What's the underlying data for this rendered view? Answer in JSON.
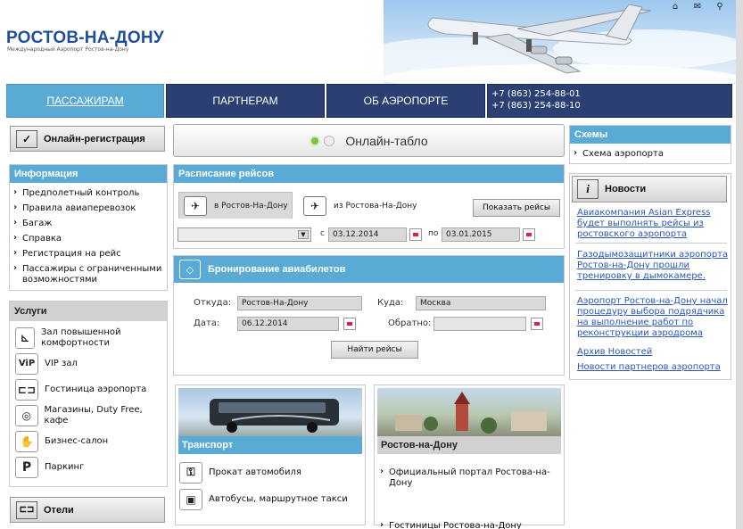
{
  "header": {
    "logo_title": "РОСТОВ-НА-ДОНУ",
    "logo_subtitle": "Международный Аэропорт Ростов-на-Дону",
    "icons": [
      "home-icon",
      "mail-icon",
      "sitemap-icon"
    ]
  },
  "nav": {
    "items": [
      "ПАССАЖИРАМ",
      "ПАРТНЕРАМ",
      "ОБ АЭРОПОРТЕ"
    ],
    "phone1": "+7 (863) 254-88-01",
    "phone2": "+7 (863) 254-88-10"
  },
  "left": {
    "checkin_label": "Онлайн-регистрация",
    "info_title": "Информация",
    "info_items": [
      "Предполетный контроль",
      "Правила авиаперевозок",
      "Багаж",
      "Справка",
      "Регистрация на рейс",
      "Пассажиры с ограниченными возможностями"
    ],
    "services_title": "Услуги",
    "services": [
      {
        "label": "Зал повышенной комфортности",
        "icon": "seat-icon"
      },
      {
        "label": "VIP зал",
        "icon": "vip-icon"
      },
      {
        "label": "Гостиница аэропорта",
        "icon": "bed-icon"
      },
      {
        "label": "Магазины, Duty Free, кафе",
        "icon": "plate-icon"
      },
      {
        "label": "Бизнес-салон",
        "icon": "handshake-icon"
      },
      {
        "label": "Паркинг",
        "icon": "parking-icon"
      }
    ],
    "hotels_label": "Отели"
  },
  "center": {
    "board_label": "Онлайн-табло",
    "schedule_title": "Расписание рейсов",
    "tab_arrivals": "в Ростов-На-Дону",
    "tab_departures": "из Ростова-На-Дону",
    "show_flights": "Показать рейсы",
    "date_from_prefix": "с",
    "date_from": "03.12.2014",
    "date_to_prefix": "по",
    "date_to": "03.01.2015",
    "booking_title": "Бронирование авиабилетов",
    "from_label": "Откуда:",
    "from_value": "Ростов-На-Дону",
    "to_label": "Куда:",
    "to_value": "Москва",
    "date_label": "Дата:",
    "date_value": "06.12.2014",
    "return_label": "Обратно:",
    "return_value": "",
    "find_button": "Найти рейсы",
    "transport_title": "Транспорт",
    "transport_items": [
      "Прокат автомобиля",
      "Автобусы, маршрутное такси"
    ],
    "city_title": "Ростов-на-Дону",
    "city_items": [
      "Официальный портал Ростова-на-Дону",
      "Гостиницы Ростова-на-Дону"
    ]
  },
  "right": {
    "schemes_title": "Схемы",
    "schemes_item": "Схема аэропорта",
    "news_title": "Новости",
    "news": [
      "Авиакомпания Asian Express будет выполнять рейсы из ростовского аэропорта",
      "Газодымозащитники аэропорта Ростов-на-Дону прошли тренировку в дымокамере.",
      "Аэропорт Ростов-на-Дону начал процедуру выбора подрядчика на выполнение работ по реконструкции аэродрома"
    ],
    "archive": "Архив Новостей",
    "partners_news": "Новости партнеров аэропорта"
  }
}
